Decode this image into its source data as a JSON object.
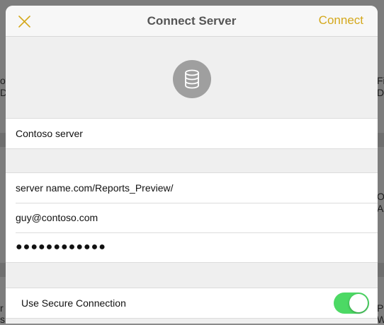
{
  "background_app": {
    "left_fragments": [
      "ov",
      "Da",
      "r",
      "s"
    ],
    "right_fragments": [
      "Fi",
      "Da",
      "Op",
      "Ar",
      "Po",
      "W"
    ]
  },
  "dialog": {
    "title": "Connect Server",
    "close_icon": "close-x-icon",
    "connect_label": "Connect",
    "accent_color": "#d4a81c",
    "server_icon": "database-icon"
  },
  "fields": {
    "display_name": "Contoso server",
    "server_address": "server name.com/Reports_Preview/",
    "username": "guy@contoso.com",
    "password_mask": "●●●●●●●●●●●●"
  },
  "secure_connection": {
    "label": "Use Secure Connection",
    "enabled": true,
    "toggle_color": "#4cd964"
  }
}
